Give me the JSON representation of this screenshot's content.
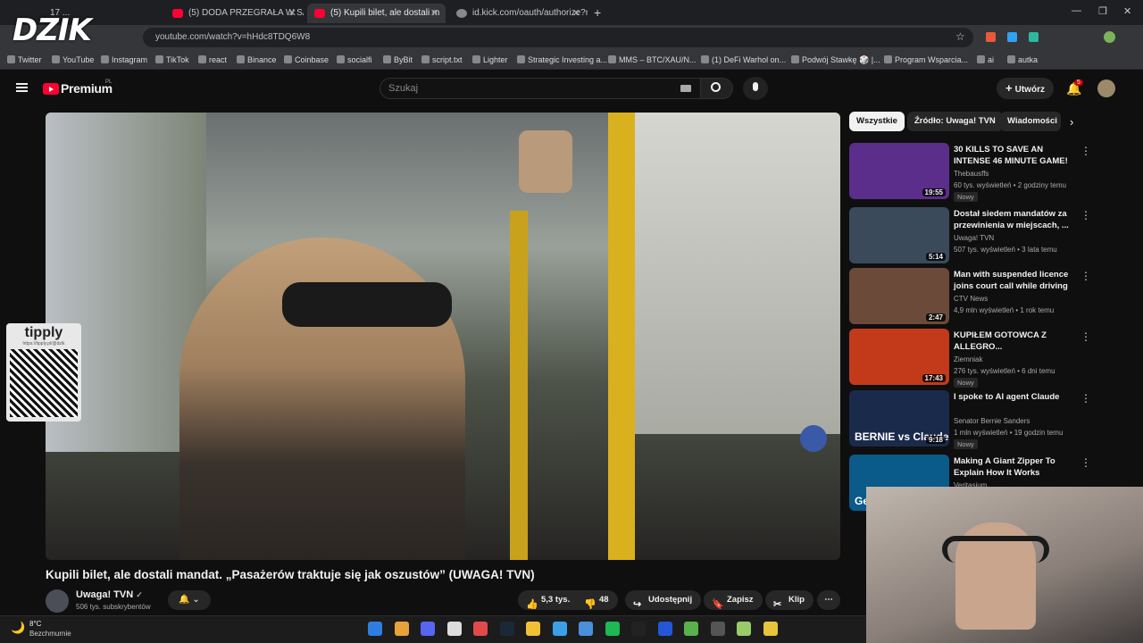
{
  "browser": {
    "tabs": [
      {
        "label": "17 ..."
      },
      {
        "label": "(5) DODA PRZEGRAŁA W SĄDZIE"
      },
      {
        "label": "(5) Kupili bilet, ale dostali m"
      },
      {
        "label": "id.kick.com/oauth/authorize?re"
      }
    ],
    "url": "youtube.com/watch?v=hHdc8TDQ6W8",
    "bookmarks": [
      "Twitter",
      "YouTube",
      "Instagram",
      "TikTok",
      "react",
      "Binance",
      "Coinbase",
      "socialfi",
      "ByBit",
      "script.txt",
      "Lighter",
      "Strategic Investing a...",
      "MMS – BTC/XAU/N...",
      "(1) DeFi Warhol on...",
      "Podwój Stawkę 🎲 |...",
      "Program Wsparcia...",
      "ai",
      "autka"
    ]
  },
  "overlay": {
    "streamer_logo": "DZIK",
    "donation_brand": "tipply",
    "donation_url": "https://tipply.pl/@dzik"
  },
  "youtube": {
    "logo": "Premium",
    "logo_region": "PL",
    "search_placeholder": "Szukaj",
    "create_label": "Utwórz",
    "notif_count": "5",
    "video": {
      "title": "Kupili bilet, ale dostali mandat. „Pasażerów traktuje się jak oszustów” (UWAGA! TVN)",
      "channel": "Uwaga! TVN",
      "subs": "506 tys. subskrybentów",
      "likes": "5,3 tys.",
      "dislikes": "48",
      "share": "Udostępnij",
      "save": "Zapisz",
      "clip": "Klip"
    },
    "chips": [
      "Wszystkie",
      "Źródło: Uwaga! TVN",
      "Wiadomości"
    ],
    "recs": [
      {
        "title": "30 KILLS TO SAVE AN INTENSE 46 MINUTE GAME!",
        "channel": "Thebausffs",
        "meta": "60 tys. wyświetleń • 2 godziny temu",
        "badge": "Nowy",
        "duration": "19:55",
        "color": "#5a2e8a"
      },
      {
        "title": "Dostał siedem mandatów za przewinienia w miejscach, ...",
        "channel": "Uwaga! TVN",
        "meta": "507 tys. wyświetleń • 3 lata temu",
        "badge": "",
        "duration": "5:14",
        "color": "#3b4a5a"
      },
      {
        "title": "Man with suspended licence joins court call while driving",
        "channel": "CTV News",
        "meta": "4,9 mln wyświetleń • 1 rok temu",
        "badge": "",
        "duration": "2:47",
        "color": "#6b4a3a"
      },
      {
        "title": "KUPIŁEM GOTOWCA Z ALLEGRO...",
        "channel": "Ziemniak",
        "meta": "276 tys. wyświetleń • 6 dni temu",
        "badge": "Nowy",
        "duration": "17:43",
        "color": "#c33a1a"
      },
      {
        "title": "I spoke to AI agent Claude",
        "channel": "Senator Bernie Sanders",
        "meta": "1 mln wyświetleń • 19 godzin temu",
        "badge": "Nowy",
        "duration": "9:18",
        "color": "#1a2a4a",
        "thumb_text": "BERNIE vs Claude"
      },
      {
        "title": "Making A Giant Zipper To Explain How It Works",
        "channel": "Veritasium",
        "meta": "",
        "badge": "",
        "duration": "",
        "color": "#0a5a8a",
        "thumb_text": "Genius"
      }
    ]
  },
  "taskbar": {
    "temp": "8°C",
    "weather": "Bezchmurnie"
  }
}
